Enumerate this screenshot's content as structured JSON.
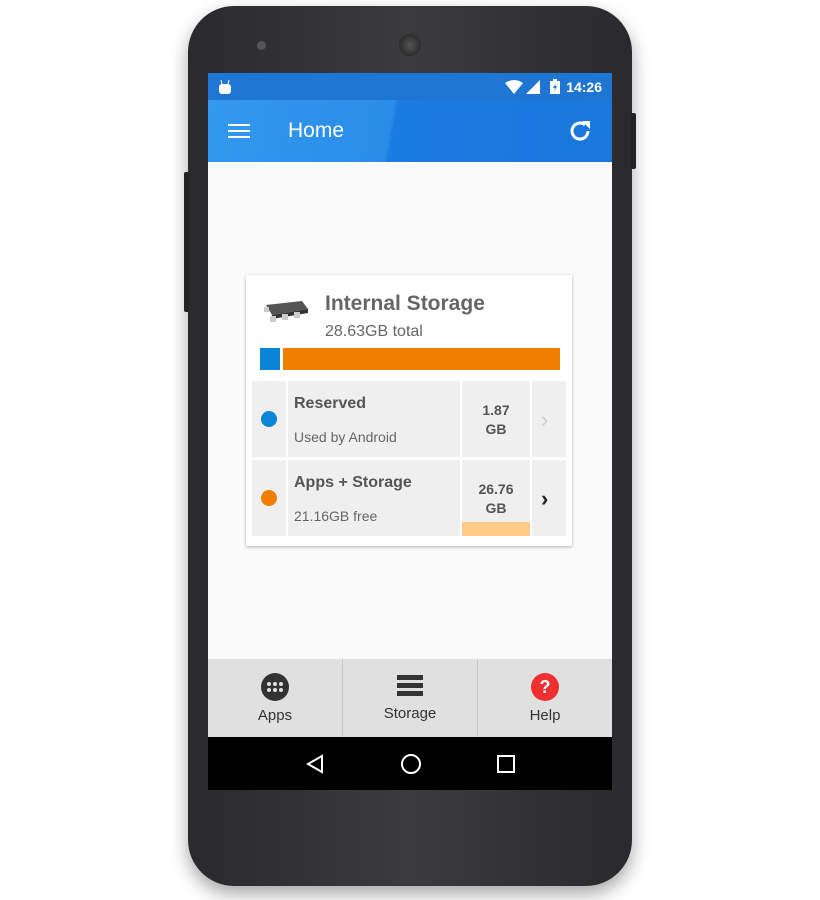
{
  "status_bar": {
    "time": "14:26",
    "icons": [
      "android-icon",
      "wifi-icon",
      "signal-icon",
      "battery-charging-icon"
    ]
  },
  "app_bar": {
    "title": "Home",
    "menu_icon": "menu-icon",
    "refresh_icon": "refresh-icon"
  },
  "storage_card": {
    "title": "Internal Storage",
    "total": "28.63GB total",
    "usage_bar": {
      "reserved_gb": 1.87,
      "apps_gb": 26.76,
      "total_gb": 28.63
    },
    "colors": {
      "reserved": "#0a84d6",
      "apps": "#f07f00",
      "apps_free_bar": "#ffcc88"
    },
    "rows": [
      {
        "label": "Reserved",
        "sub": "Used by Android",
        "value_num": "1.87",
        "value_unit": "GB",
        "enabled": false
      },
      {
        "label": "Apps + Storage",
        "sub": "21.16GB free",
        "value_num": "26.76",
        "value_unit": "GB",
        "enabled": true
      }
    ]
  },
  "bottom_nav": [
    {
      "label": "Apps",
      "icon": "apps-grid-icon"
    },
    {
      "label": "Storage",
      "icon": "storage-list-icon"
    },
    {
      "label": "Help",
      "icon": "help-icon"
    }
  ],
  "system_nav": [
    "back-icon",
    "home-icon",
    "recents-icon"
  ]
}
